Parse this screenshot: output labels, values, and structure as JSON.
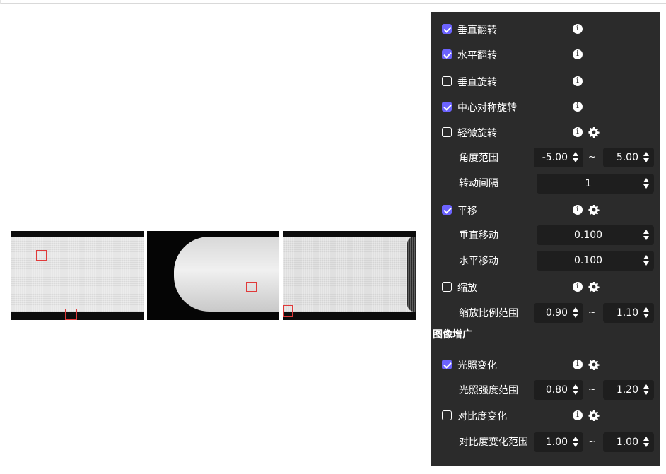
{
  "panel": {
    "vertical_flip": {
      "label": "垂直翻转",
      "checked": true
    },
    "horizontal_flip": {
      "label": "水平翻转",
      "checked": true
    },
    "vertical_rotate": {
      "label": "垂直旋转",
      "checked": false
    },
    "center_rotate": {
      "label": "中心对称旋转",
      "checked": true
    },
    "slight_rotate": {
      "label": "轻微旋转",
      "checked": false,
      "angle_range_label": "角度范围",
      "angle_min": "-5.00",
      "angle_max": "5.00",
      "step_label": "转动间隔",
      "step_value": "1"
    },
    "translate": {
      "label": "平移",
      "checked": true,
      "vertical_label": "垂直移动",
      "vertical_value": "0.100",
      "horizontal_label": "水平移动",
      "horizontal_value": "0.100"
    },
    "scale": {
      "label": "缩放",
      "checked": false,
      "range_label": "缩放比例范围",
      "range_min": "0.90",
      "range_max": "1.10"
    },
    "augment_section": "图像增广",
    "lighting": {
      "label": "光照变化",
      "checked": true,
      "range_label": "光照强度范围",
      "range_min": "0.80",
      "range_max": "1.20"
    },
    "contrast": {
      "label": "对比度变化",
      "checked": false,
      "range_label": "对比度变化范围",
      "range_min": "1.00",
      "range_max": "1.00"
    },
    "tilde": "~",
    "info_glyph": "i"
  },
  "colors": {
    "panel_bg": "#2b2b2b",
    "accent": "#6c63ff",
    "input_bg": "#1e1e1e",
    "marker": "#e03a3a"
  },
  "icons": [
    "info-icon",
    "gear-icon",
    "check-icon",
    "spin-arrows-icon"
  ]
}
